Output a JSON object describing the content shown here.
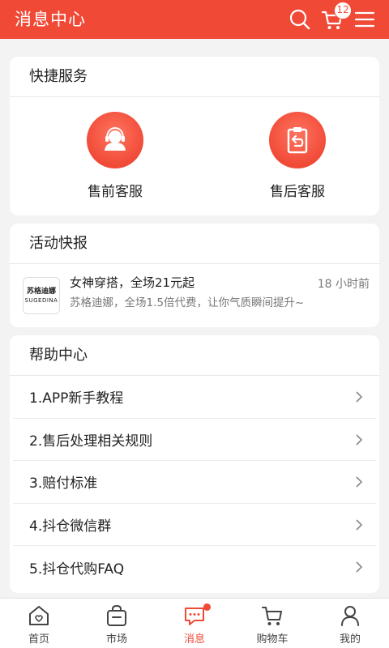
{
  "header": {
    "title": "消息中心",
    "cart_count": "12",
    "icons": {
      "search": "search-icon",
      "cart": "cart-icon",
      "menu": "menu-icon"
    }
  },
  "quick_services": {
    "title": "快捷服务",
    "items": [
      {
        "label": "售前客服",
        "icon": "customer-service-icon"
      },
      {
        "label": "售后客服",
        "icon": "clipboard-return-icon"
      }
    ]
  },
  "activity": {
    "title": "活动快报",
    "items": [
      {
        "logo_line1": "苏格迪娜",
        "logo_line2": "SUGEDINA",
        "title": "女神穿搭，全场21元起",
        "subtitle": "苏格迪娜，全场1.5倍代费，让你气质瞬间提升~",
        "time": "18 小时前"
      }
    ]
  },
  "help_center": {
    "title": "帮助中心",
    "items": [
      {
        "label": "1.APP新手教程"
      },
      {
        "label": "2.售后处理相关规则"
      },
      {
        "label": "3.赔付标准"
      },
      {
        "label": "4.抖仓微信群"
      },
      {
        "label": "5.抖仓代购FAQ"
      }
    ]
  },
  "bottom_nav": {
    "items": [
      {
        "label": "首页",
        "icon": "home-icon"
      },
      {
        "label": "市场",
        "icon": "market-bag-icon"
      },
      {
        "label": "消息",
        "icon": "message-icon",
        "active": true
      },
      {
        "label": "购物车",
        "icon": "cart-icon"
      },
      {
        "label": "我的",
        "icon": "user-icon"
      }
    ]
  },
  "colors": {
    "accent": "#f04a37",
    "background": "#f3f3f3",
    "card": "#ffffff"
  }
}
